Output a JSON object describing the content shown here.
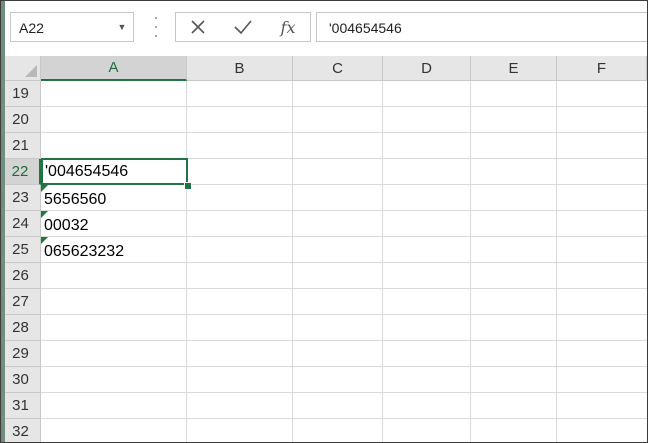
{
  "name_box": {
    "value": "A22"
  },
  "formula_bar": {
    "cancel_icon": "close-icon",
    "enter_icon": "check-icon",
    "function_label": "fx",
    "content": "'004654546"
  },
  "columns": [
    "A",
    "B",
    "C",
    "D",
    "E",
    "F"
  ],
  "active_column": "A",
  "rows": [
    "19",
    "20",
    "21",
    "22",
    "23",
    "24",
    "25",
    "26",
    "27",
    "28",
    "29",
    "30",
    "31",
    "32"
  ],
  "active_row": "22",
  "cells": {
    "A22": "'004654546",
    "A23": "5656560",
    "A24": "00032",
    "A25": "065623232"
  },
  "error_indicator_color": "#1f7a3a",
  "selection_color": "#217346"
}
